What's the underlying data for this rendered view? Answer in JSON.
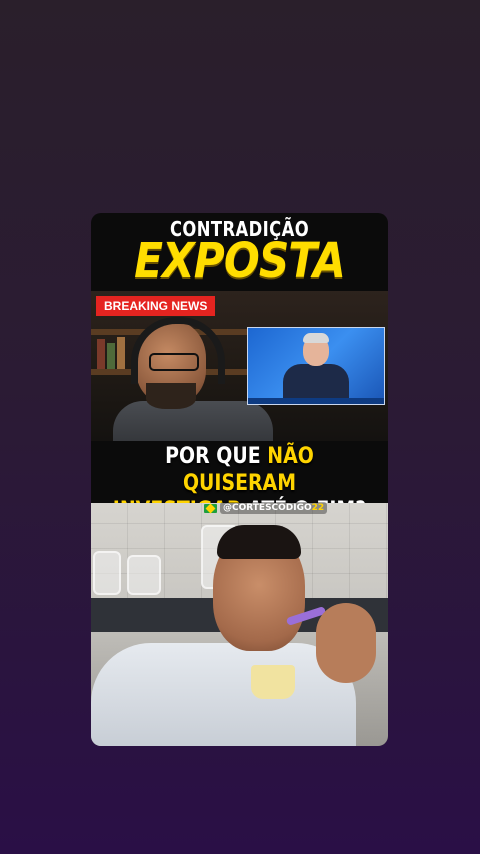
{
  "video": {
    "headline_line1": "CONTRADIÇÃO",
    "headline_line2": "EXPOSTA",
    "badge": "BREAKING NEWS",
    "question": {
      "part1": "POR QUE ",
      "part2": "NÃO QUISERAM",
      "part3": "INVESTIGAR",
      "part4": " ATÉ O FIM?"
    },
    "watermark": {
      "handle": "@CORTESCODIGO",
      "number": "22",
      "flag_icon": "brazil-flag-icon"
    }
  },
  "colors": {
    "background_top": "#2a1f2b",
    "background_bottom": "#2a0f46",
    "headline_yellow": "#ffdd00",
    "breaking_red": "#e52420"
  }
}
